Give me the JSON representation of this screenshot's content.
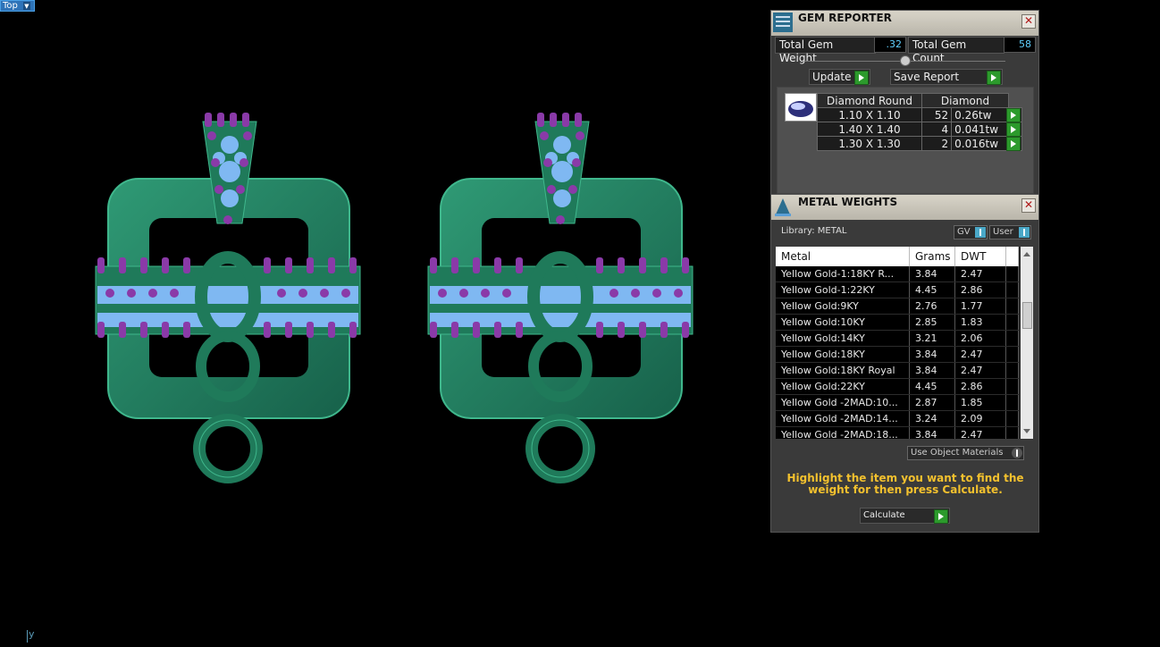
{
  "viewport": {
    "view_label": "Top",
    "axis_label": "y"
  },
  "gem_reporter": {
    "title": "GEM REPORTER",
    "total_weight_label": "Total Gem Weight",
    "total_weight_value": ".32",
    "total_count_label": "Total Gem Count",
    "total_count_value": "58",
    "update_label": "Update",
    "save_label": "Save Report",
    "table_headers": [
      "Diamond Round",
      "Diamond"
    ],
    "rows": [
      {
        "size": "1.10 X 1.10",
        "count": "52",
        "weight": "0.26tw"
      },
      {
        "size": "1.40 X 1.40",
        "count": "4",
        "weight": "0.041tw"
      },
      {
        "size": "1.30 X 1.30",
        "count": "2",
        "weight": "0.016tw"
      }
    ]
  },
  "metal_weights": {
    "title": "METAL WEIGHTS",
    "library_label": "Library: METAL",
    "toggle_gv": "GV",
    "toggle_user": "User",
    "columns": [
      "Metal",
      "Grams",
      "DWT"
    ],
    "rows": [
      {
        "metal": "Yellow Gold-1:18KY R...",
        "grams": "3.84",
        "dwt": "2.47"
      },
      {
        "metal": "Yellow Gold-1:22KY",
        "grams": "4.45",
        "dwt": "2.86"
      },
      {
        "metal": "Yellow Gold:9KY",
        "grams": "2.76",
        "dwt": "1.77"
      },
      {
        "metal": "Yellow Gold:10KY",
        "grams": "2.85",
        "dwt": "1.83"
      },
      {
        "metal": "Yellow Gold:14KY",
        "grams": "3.21",
        "dwt": "2.06"
      },
      {
        "metal": "Yellow Gold:18KY",
        "grams": "3.84",
        "dwt": "2.47"
      },
      {
        "metal": "Yellow Gold:18KY Royal",
        "grams": "3.84",
        "dwt": "2.47"
      },
      {
        "metal": "Yellow Gold:22KY",
        "grams": "4.45",
        "dwt": "2.86"
      },
      {
        "metal": "Yellow Gold -2MAD:10...",
        "grams": "2.87",
        "dwt": "1.85"
      },
      {
        "metal": "Yellow Gold -2MAD:14...",
        "grams": "3.24",
        "dwt": "2.09"
      },
      {
        "metal": "Yellow Gold -2MAD:18...",
        "grams": "3.84",
        "dwt": "2.47"
      }
    ],
    "use_object_materials": "Use Object Materials",
    "hint": "Highlight the item you want to find the weight for then press Calculate.",
    "calculate_label": "Calculate"
  },
  "colors": {
    "metal_green": "#1f7a5a",
    "stone_blue": "#7fb8f2",
    "prong_purple": "#8a3aa8",
    "hint_yellow": "#f3c12e"
  }
}
